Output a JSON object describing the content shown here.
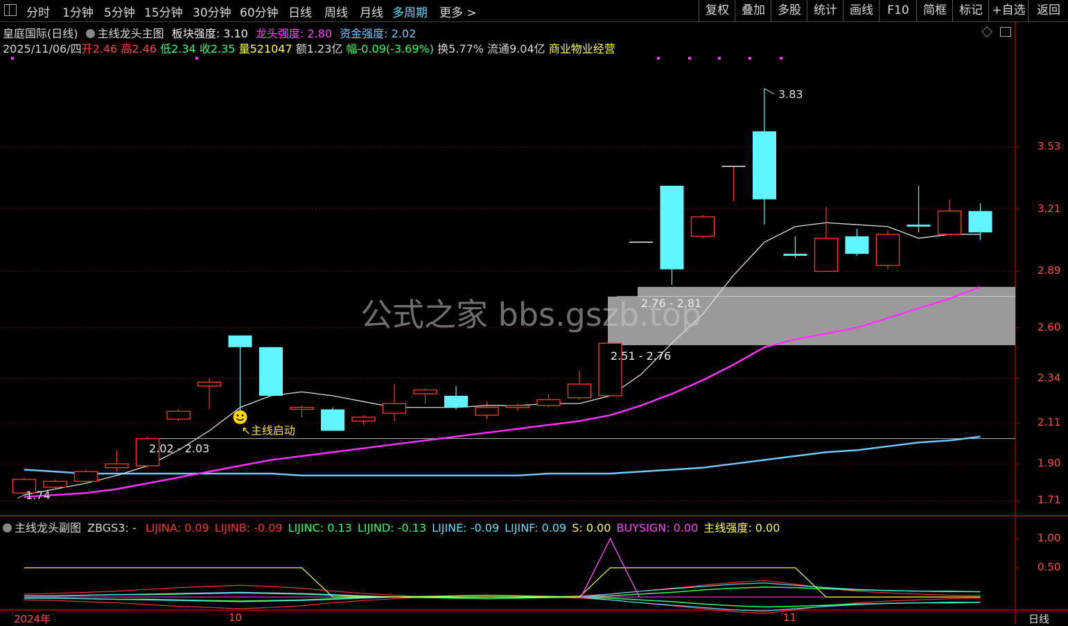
{
  "toolbar": {
    "left_items": [
      "分时",
      "1分钟",
      "5分钟",
      "15分钟",
      "30分钟",
      "60分钟",
      "日线",
      "周线",
      "月线",
      "多周期",
      "更多 >"
    ],
    "active": "多周期",
    "right_items": [
      "复权",
      "叠加",
      "多股",
      "统计",
      "画线",
      "F10",
      "简框",
      "标记",
      "+自选",
      "返回"
    ]
  },
  "header": {
    "stock": "皇庭国际(日线)",
    "indicator": "主线龙头主图",
    "sector_label": "板块强度:",
    "sector_value": "3.10",
    "leader_label": "龙头强度:",
    "leader_value": "2.80",
    "fund_label": "资金强度:",
    "fund_value": "2.02"
  },
  "quote": {
    "date": "2025/11/06/四",
    "open_label": "开",
    "open": "2.46",
    "high_label": "高",
    "high": "2.46",
    "low_label": "低",
    "low": "2.34",
    "close_label": "收",
    "close": "2.35",
    "vol_label": "量",
    "vol": "521047",
    "amount": "额1.23亿",
    "change": "幅-0.09(-3.69%)",
    "turnover": "换5.77%",
    "float": "流通9.04亿",
    "industry": "商业物业经营"
  },
  "sub_header": {
    "indicator": "主线龙头副图",
    "zbgs": "ZBGS3: -",
    "items": [
      {
        "label": "LIJINA: 0.09",
        "color": "#ff3030"
      },
      {
        "label": "LIJINB: -0.09",
        "color": "#ff3030"
      },
      {
        "label": "LIJINC: 0.13",
        "color": "#30ff60"
      },
      {
        "label": "LIJIND: -0.13",
        "color": "#30ff60"
      },
      {
        "label": "LIJINE: -0.09",
        "color": "#5fe0ff"
      },
      {
        "label": "LIJINF: 0.09",
        "color": "#5fe0ff"
      },
      {
        "label": "S: 0.00",
        "color": "#ffff40"
      },
      {
        "label": "BUYSIGN: 0.00",
        "color": "#ff40ff"
      },
      {
        "label": "主线强度: 0.00",
        "color": "#ffff40"
      }
    ]
  },
  "annotations": {
    "start_signal": "主线启动",
    "high_marker": "3.83",
    "low_marker": "1.74",
    "zone1": "2.76 - 2.81",
    "zone2": "2.51 - 2.76",
    "zone3": "2.02 - 2.03",
    "watermark": "公式之家 bbs.gszb.top"
  },
  "axis": {
    "price_ticks": [
      "3.53",
      "3.21",
      "2.89",
      "2.60",
      "2.34",
      "2.11",
      "1.90",
      "1.71"
    ],
    "sub_ticks": [
      "1.00",
      "0.50"
    ],
    "date_labels": [
      "2024年",
      "10",
      "11"
    ],
    "period": "日线"
  },
  "colors": {
    "up": "#ff3030",
    "down": "#5ff6ff",
    "ma_short": "#e0e0e0",
    "ma_mid": "#ff30ff",
    "ma_long": "#70c8ff",
    "zone": "#a0a0a0"
  },
  "chart_data": {
    "type": "candlestick",
    "ylim": [
      1.64,
      4.0
    ],
    "candles": [
      {
        "o": 1.75,
        "h": 1.83,
        "l": 1.73,
        "c": 1.82
      },
      {
        "o": 1.78,
        "h": 1.82,
        "l": 1.77,
        "c": 1.81
      },
      {
        "o": 1.81,
        "h": 1.87,
        "l": 1.8,
        "c": 1.86
      },
      {
        "o": 1.88,
        "h": 1.97,
        "l": 1.86,
        "c": 1.9
      },
      {
        "o": 1.89,
        "h": 2.04,
        "l": 1.88,
        "c": 2.03
      },
      {
        "o": 2.13,
        "h": 2.18,
        "l": 2.12,
        "c": 2.17
      },
      {
        "o": 2.3,
        "h": 2.34,
        "l": 2.18,
        "c": 2.32
      },
      {
        "o": 2.56,
        "h": 2.56,
        "l": 2.12,
        "c": 2.5
      },
      {
        "o": 2.5,
        "h": 2.5,
        "l": 2.25,
        "c": 2.25
      },
      {
        "o": 2.18,
        "h": 2.2,
        "l": 2.14,
        "c": 2.19
      },
      {
        "o": 2.18,
        "h": 2.19,
        "l": 2.07,
        "c": 2.07
      },
      {
        "o": 2.12,
        "h": 2.15,
        "l": 2.1,
        "c": 2.14
      },
      {
        "o": 2.16,
        "h": 2.31,
        "l": 2.12,
        "c": 2.21
      },
      {
        "o": 2.26,
        "h": 2.29,
        "l": 2.21,
        "c": 2.28
      },
      {
        "o": 2.25,
        "h": 2.3,
        "l": 2.18,
        "c": 2.19
      },
      {
        "o": 2.15,
        "h": 2.22,
        "l": 2.13,
        "c": 2.19
      },
      {
        "o": 2.19,
        "h": 2.21,
        "l": 2.17,
        "c": 2.2
      },
      {
        "o": 2.2,
        "h": 2.26,
        "l": 2.19,
        "c": 2.23
      },
      {
        "o": 2.24,
        "h": 2.38,
        "l": 2.23,
        "c": 2.31
      },
      {
        "o": 2.25,
        "h": 2.52,
        "l": 2.25,
        "c": 2.52
      },
      {
        "o": 3.04,
        "h": 3.04,
        "l": 3.04,
        "c": 3.04
      },
      {
        "o": 3.33,
        "h": 3.33,
        "l": 2.82,
        "c": 2.9
      },
      {
        "o": 3.07,
        "h": 3.18,
        "l": 3.06,
        "c": 3.17
      },
      {
        "o": 3.43,
        "h": 3.43,
        "l": 3.25,
        "c": 3.43
      },
      {
        "o": 3.61,
        "h": 3.83,
        "l": 3.13,
        "c": 3.26
      },
      {
        "o": 2.98,
        "h": 3.07,
        "l": 2.96,
        "c": 2.97
      },
      {
        "o": 2.89,
        "h": 3.22,
        "l": 2.89,
        "c": 3.06
      },
      {
        "o": 3.07,
        "h": 3.11,
        "l": 2.97,
        "c": 2.98
      },
      {
        "o": 2.92,
        "h": 3.1,
        "l": 2.9,
        "c": 3.08
      },
      {
        "o": 3.13,
        "h": 3.33,
        "l": 3.09,
        "c": 3.12
      },
      {
        "o": 3.08,
        "h": 3.26,
        "l": 3.08,
        "c": 3.2
      },
      {
        "o": 3.2,
        "h": 3.24,
        "l": 3.05,
        "c": 3.09
      }
    ],
    "ma_short": [
      1.74,
      1.77,
      1.8,
      1.84,
      1.89,
      1.97,
      2.07,
      2.19,
      2.25,
      2.27,
      2.25,
      2.22,
      2.19,
      2.19,
      2.19,
      2.2,
      2.2,
      2.21,
      2.21,
      2.25,
      2.36,
      2.52,
      2.67,
      2.87,
      3.04,
      3.12,
      3.14,
      3.13,
      3.12,
      3.06,
      3.08,
      3.08
    ],
    "ma_mid": [
      1.73,
      1.74,
      1.75,
      1.77,
      1.8,
      1.83,
      1.86,
      1.89,
      1.92,
      1.94,
      1.96,
      1.98,
      2.0,
      2.02,
      2.04,
      2.06,
      2.08,
      2.1,
      2.12,
      2.15,
      2.2,
      2.26,
      2.33,
      2.41,
      2.5,
      2.54,
      2.57,
      2.6,
      2.65,
      2.7,
      2.75,
      2.81
    ],
    "ma_long": [
      1.87,
      1.86,
      1.85,
      1.85,
      1.85,
      1.85,
      1.85,
      1.85,
      1.85,
      1.84,
      1.84,
      1.84,
      1.84,
      1.84,
      1.84,
      1.84,
      1.84,
      1.85,
      1.85,
      1.85,
      1.86,
      1.87,
      1.88,
      1.9,
      1.92,
      1.94,
      1.96,
      1.97,
      1.99,
      2.01,
      2.02,
      2.04
    ],
    "support_zones": [
      {
        "low": 2.76,
        "high": 2.81,
        "label": "2.76 - 2.81"
      },
      {
        "low": 2.51,
        "high": 2.76,
        "label": "2.51 - 2.76"
      },
      {
        "low": 2.02,
        "high": 2.03,
        "label": "2.02 - 2.03"
      }
    ],
    "sub_series": {
      "ylim": [
        -0.2,
        1.2
      ],
      "buysign": [
        0,
        0,
        0,
        0,
        0,
        0,
        0,
        0,
        0,
        0,
        0,
        0,
        0,
        0,
        0,
        0,
        0,
        0,
        0,
        1,
        0,
        0,
        0,
        0,
        0,
        0,
        0,
        0,
        0,
        0,
        0,
        0
      ],
      "s_line": [
        0.5,
        0.5,
        0.5,
        0.5,
        0.5,
        0.5,
        0.5,
        0.5,
        0.5,
        0.5,
        0.0,
        0.0,
        0.0,
        0.0,
        0.0,
        0.0,
        0.0,
        0.0,
        0.0,
        0.5,
        0.5,
        0.5,
        0.5,
        0.5,
        0.5,
        0.5,
        0.0,
        0.0,
        0.0,
        0.0,
        0.0,
        0.0
      ],
      "red": [
        0.05,
        0.06,
        0.08,
        0.1,
        0.13,
        0.16,
        0.18,
        0.2,
        0.18,
        0.15,
        0.1,
        0.06,
        0.03,
        0.0,
        -0.02,
        -0.03,
        -0.02,
        0.0,
        0.02,
        0.05,
        0.1,
        0.15,
        0.2,
        0.25,
        0.28,
        0.22,
        0.15,
        0.1,
        0.07,
        0.05,
        0.03,
        0.02
      ],
      "green": [
        0.02,
        0.02,
        0.03,
        0.04,
        0.04,
        0.05,
        0.06,
        0.07,
        0.06,
        0.05,
        0.03,
        0.01,
        0.0,
        -0.01,
        -0.02,
        -0.03,
        -0.02,
        -0.01,
        0.0,
        0.02,
        0.05,
        0.08,
        0.12,
        0.15,
        0.17,
        0.16,
        0.14,
        0.12,
        0.11,
        0.1,
        0.1,
        0.09
      ],
      "cyan": [
        -0.02,
        -0.02,
        -0.03,
        -0.04,
        -0.05,
        -0.06,
        -0.07,
        -0.08,
        -0.07,
        -0.06,
        -0.04,
        -0.02,
        0.0,
        0.0,
        0.0,
        0.0,
        0.0,
        0.0,
        0.0,
        -0.05,
        -0.1,
        -0.14,
        -0.18,
        -0.22,
        -0.24,
        -0.2,
        -0.16,
        -0.13,
        -0.11,
        -0.1,
        -0.09,
        -0.09
      ]
    }
  }
}
